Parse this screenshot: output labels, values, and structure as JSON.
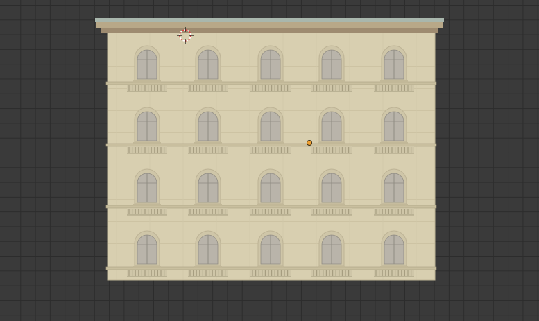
{
  "viewport": {
    "background_color": "#3a3a3a",
    "grid_color": "#2c2c2c",
    "x_axis_color": "#6f8f38",
    "y_axis_color": "#4a6fa6"
  },
  "building": {
    "floors": 4,
    "windows_per_floor": 5,
    "facade_color": "#d8cfb0",
    "cornice_color": "#b8a888",
    "window_color": "#b9b4aa"
  },
  "cursor_icon": "3d-cursor-icon",
  "origin_icon": "object-origin-icon"
}
